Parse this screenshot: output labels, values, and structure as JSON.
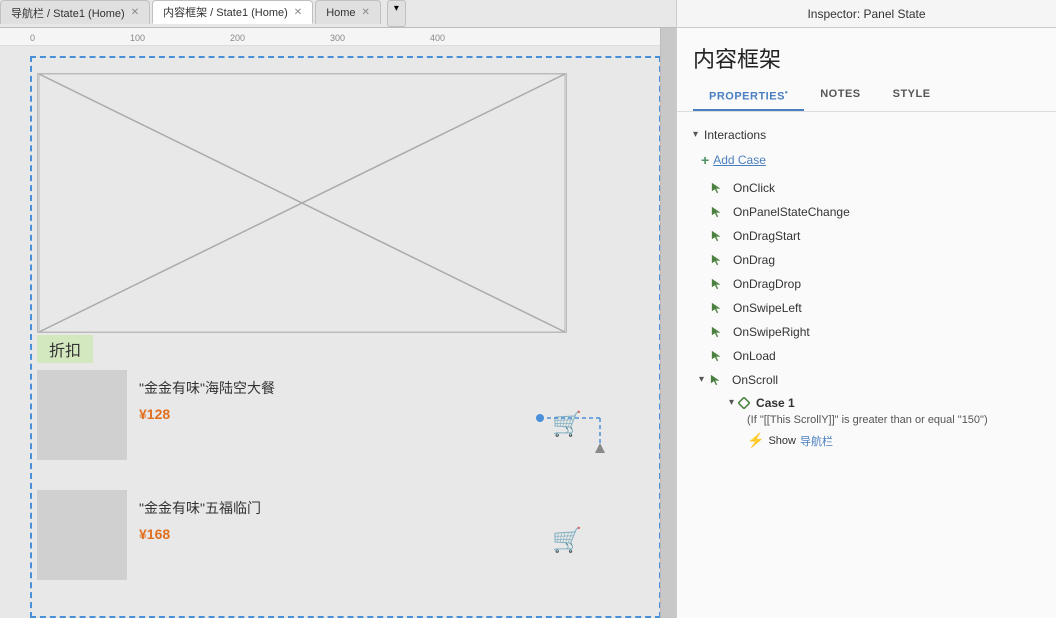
{
  "tabs": [
    {
      "id": "tab-nav",
      "label": "导航栏 / State1 (Home)",
      "active": false
    },
    {
      "id": "tab-content",
      "label": "内容框架 / State1 (Home)",
      "active": true
    },
    {
      "id": "tab-home",
      "label": "Home",
      "active": false
    }
  ],
  "inspector": {
    "title": "Inspector: Panel State",
    "panel_title": "内容框架",
    "tabs": [
      {
        "id": "properties",
        "label": "PROPERTIES",
        "active": true,
        "dot": true
      },
      {
        "id": "notes",
        "label": "NOTES",
        "active": false
      },
      {
        "id": "style",
        "label": "STYLE",
        "active": false
      }
    ],
    "section": {
      "label": "Interactions",
      "add_case_label": "Add Case"
    },
    "interactions": [
      {
        "id": "onClick",
        "label": "OnClick"
      },
      {
        "id": "onPanelStateChange",
        "label": "OnPanelStateChange"
      },
      {
        "id": "onDragStart",
        "label": "OnDragStart"
      },
      {
        "id": "onDrag",
        "label": "OnDrag"
      },
      {
        "id": "onDragDrop",
        "label": "OnDragDrop"
      },
      {
        "id": "onSwipeLeft",
        "label": "OnSwipeLeft"
      },
      {
        "id": "onSwipeRight",
        "label": "OnSwipeRight"
      },
      {
        "id": "onLoad",
        "label": "OnLoad"
      },
      {
        "id": "onScroll",
        "label": "OnScroll",
        "expanded": true
      }
    ],
    "onscroll_case": {
      "case_label": "Case 1",
      "condition": "(If \"[[This ScrollY]]\" is greater than or equal \"150\")",
      "action_prefix": "Show",
      "action_target": "导航栏",
      "action_icon": "⚡"
    }
  },
  "canvas": {
    "ruler_marks": [
      "0",
      "100",
      "200",
      "300",
      "400"
    ],
    "discount_label": "折扣",
    "product1": {
      "name": "\"金金有味\"海陆空大餐",
      "price": "¥128"
    },
    "product2": {
      "name": "\"金金有味\"五福临门",
      "price": "¥168"
    }
  }
}
